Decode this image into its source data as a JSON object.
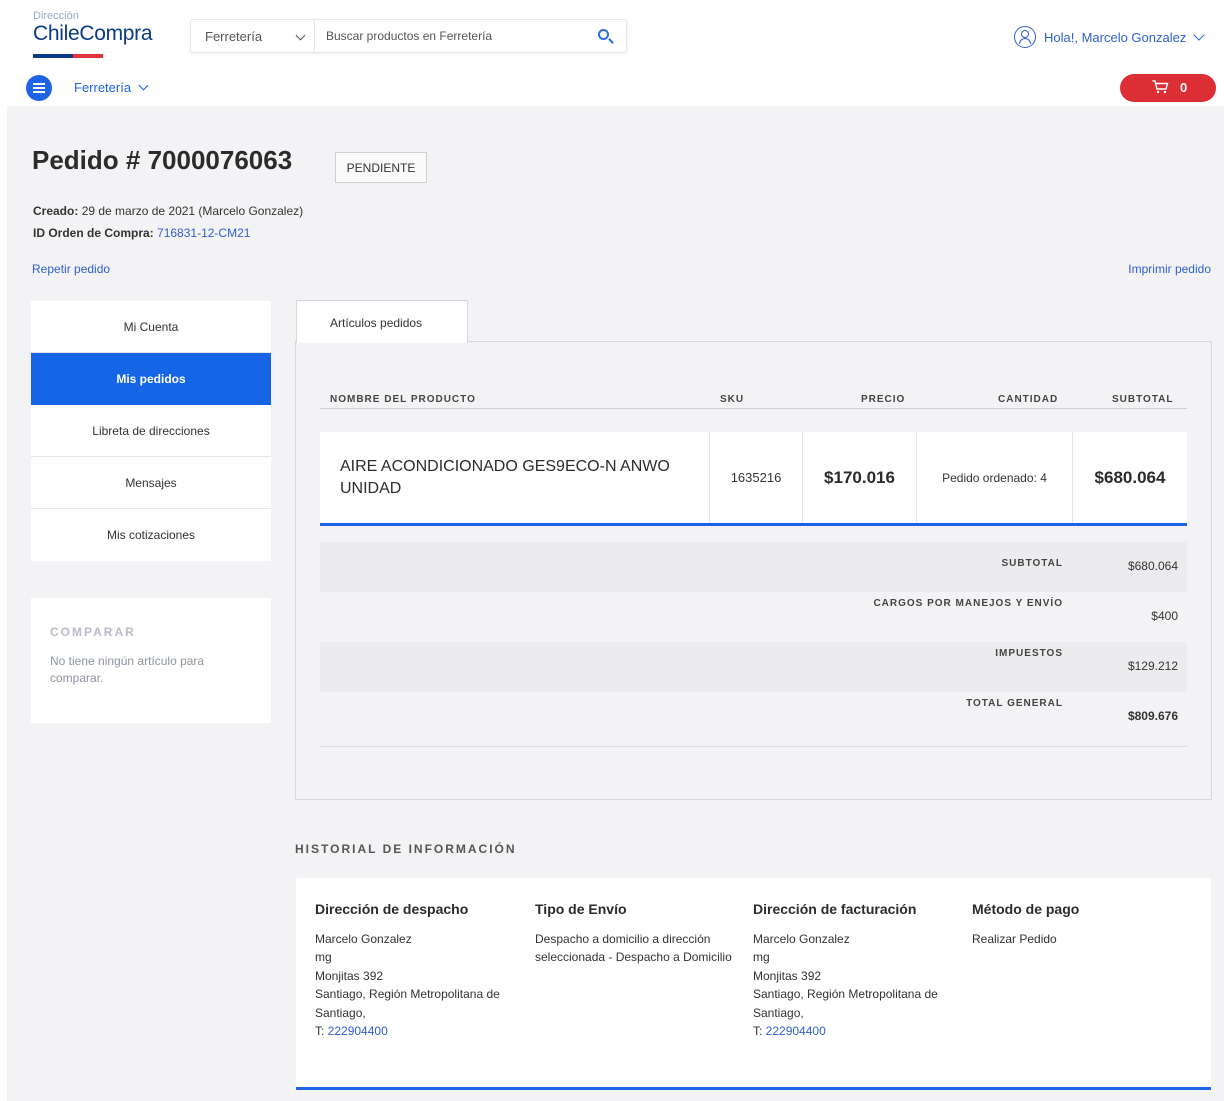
{
  "header": {
    "logo_small": "Dirección",
    "logo_big": "ChileCompra",
    "search_category": "Ferretería",
    "search_placeholder": "Buscar productos en Ferretería",
    "user_greeting": "Hola!, Marcelo Gonzalez",
    "category_nav": "Ferretería",
    "cart_count": "0"
  },
  "colors": {
    "primary_blue": "#1d63e6",
    "cart_red": "#dc2f35",
    "logo_navy": "#0a3a8a"
  },
  "order": {
    "title": "Pedido # 7000076063",
    "status": "PENDIENTE",
    "created_label": "Creado:",
    "created_value": "29 de marzo de 2021 (Marcelo Gonzalez)",
    "po_label": "ID Orden de Compra:",
    "po_value": "716831-12-CM21",
    "repeat_link": "Repetir pedido",
    "print_link": "Imprimir pedido"
  },
  "sidebar": {
    "items": [
      {
        "label": "Mi Cuenta"
      },
      {
        "label": "Mis pedidos"
      },
      {
        "label": "Libreta de direcciones"
      },
      {
        "label": "Mensajes"
      },
      {
        "label": "Mis cotizaciones"
      }
    ],
    "compare_title": "COMPARAR",
    "compare_text": "No tiene ningún artículo para comparar."
  },
  "tab_label": "Artículos pedidos",
  "table": {
    "headers": {
      "name": "NOMBRE DEL PRODUCTO",
      "sku": "SKU",
      "price": "PRECIO",
      "qty": "CANTIDAD",
      "subtotal": "SUBTOTAL"
    },
    "rows": [
      {
        "name": "AIRE ACONDICIONADO GES9ECO-N ANWO UNIDAD",
        "sku": "1635216",
        "price": "$170.016",
        "qty": "Pedido ordenado: 4",
        "subtotal": "$680.064"
      }
    ]
  },
  "totals": [
    {
      "label": "SUBTOTAL",
      "value": "$680.064"
    },
    {
      "label": "CARGOS POR MANEJOS Y ENVÍO",
      "value": "$400"
    },
    {
      "label": "IMPUESTOS",
      "value": "$129.212"
    },
    {
      "label": "TOTAL GENERAL",
      "value": "$809.676"
    }
  ],
  "history": {
    "title": "HISTORIAL DE INFORMACIÓN",
    "shipping_address": {
      "heading": "Dirección de despacho",
      "line1": "Marcelo Gonzalez",
      "line2": "mg",
      "line3": "Monjitas 392",
      "line4": "Santiago, Región Metropolitana de",
      "line5": "Santiago,",
      "phone_prefix": "T: ",
      "phone": "222904400"
    },
    "shipping_type": {
      "heading": "Tipo de Envío",
      "line1": "Despacho a domicilio a dirección",
      "line2": "seleccionada - Despacho a Domicilio"
    },
    "billing_address": {
      "heading": "Dirección de facturación",
      "line1": "Marcelo Gonzalez",
      "line2": "mg",
      "line3": "Monjitas 392",
      "line4": "Santiago, Región Metropolitana de",
      "line5": "Santiago,",
      "phone_prefix": "T: ",
      "phone": "222904400"
    },
    "payment": {
      "heading": "Método de pago",
      "line1": "Realizar Pedido"
    }
  }
}
